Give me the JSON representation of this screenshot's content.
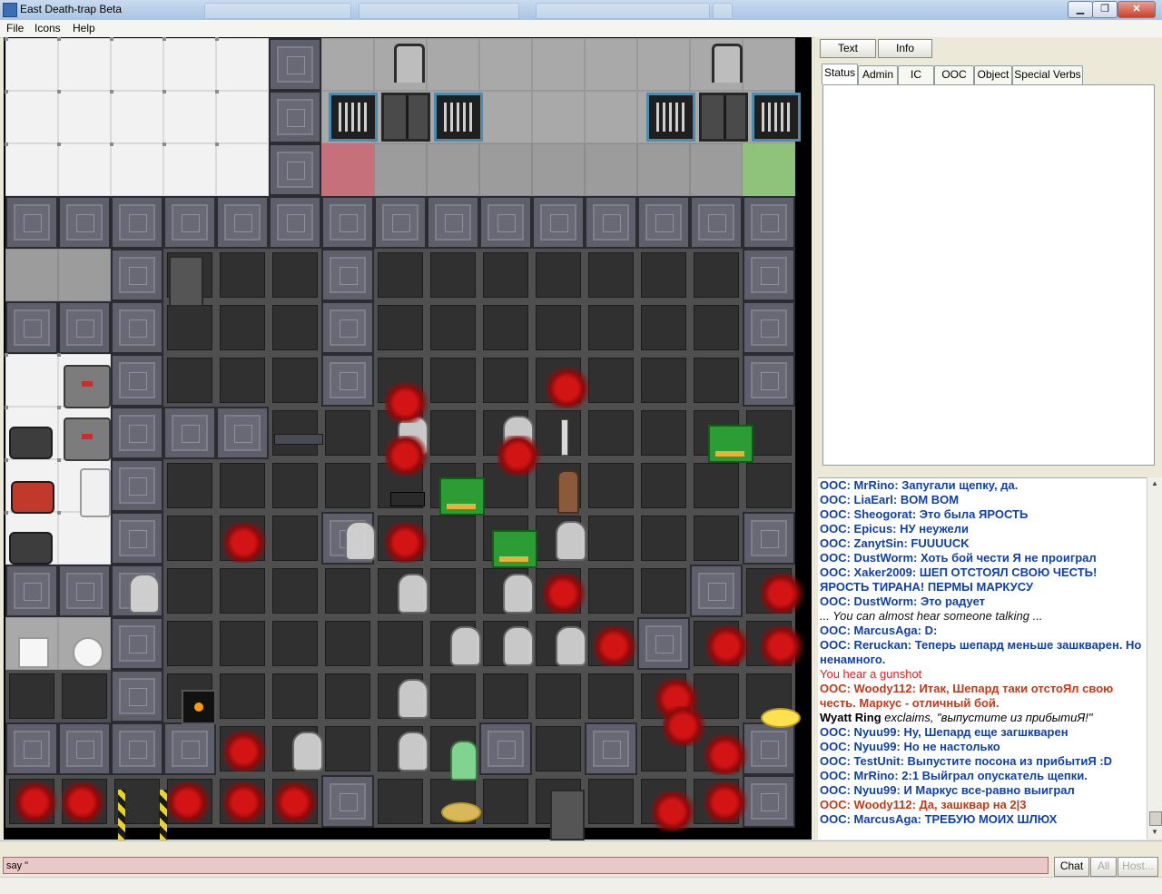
{
  "window": {
    "title": "East Death-trap Beta",
    "minimize": "▁",
    "restore": "❐",
    "close": "✕"
  },
  "menu": [
    "File",
    "Icons",
    "Help"
  ],
  "right_panel": {
    "top_buttons": [
      "Text",
      "Info"
    ],
    "tabs": [
      "Status",
      "Admin",
      "IC",
      "OOC",
      "Object",
      "Special Verbs"
    ]
  },
  "chat": [
    {
      "kind": "ooc",
      "text": "OOC: MrRino: Запугали щепку, да."
    },
    {
      "kind": "ooc",
      "text": "OOC: LiaEarl: BOM BOM"
    },
    {
      "kind": "ooc",
      "text": "OOC: Sheogorat: Это была ЯРОСТЬ"
    },
    {
      "kind": "ooc",
      "text": "OOC: Epicus: НУ неужели"
    },
    {
      "kind": "ooc",
      "text": "OOC: ZanytSin: FUUUUCK"
    },
    {
      "kind": "ooc",
      "text": "OOC: DustWorm: Хоть бой чести Я не проиграл"
    },
    {
      "kind": "ooc",
      "text": "OOC: Xaker2009: ШЕП ОТСТОЯЛ СВОЮ ЧЕСТЬ! ЯРОСТЬ ТИРАНА! ПЕРМЫ МАРКУСУ"
    },
    {
      "kind": "ooc",
      "text": "OOC: DustWorm: Это радует"
    },
    {
      "kind": "emote",
      "text": "... You can almost hear someone talking ..."
    },
    {
      "kind": "ooc",
      "text": "OOC: MarcusAga: D:"
    },
    {
      "kind": "ooc",
      "text": "OOC: Reruckan: Теперь шепард меньше зашкварен. Но ненамного."
    },
    {
      "kind": "alert",
      "text": "You hear a gunshot"
    },
    {
      "kind": "admin",
      "text": "OOC: Woody112: Итак, Шепард таки отстоЯл свою честь. Маркус - отличный бой."
    },
    {
      "kind": "say",
      "name": "Wyatt Ring",
      "text": " exclaims, \"выпустите из прибытиЯ!\""
    },
    {
      "kind": "ooc",
      "text": "OOC: Nyuu99: Ну, Шепард еще загшкварен"
    },
    {
      "kind": "ooc",
      "text": "OOC: Nyuu99: Но не настолько"
    },
    {
      "kind": "ooc",
      "text": "OOC: TestUnit: Выпустите посона из прибытиЯ :D"
    },
    {
      "kind": "ooc",
      "text": "OOC: MrRino: 2:1 Выйграл опускатель щепки."
    },
    {
      "kind": "ooc",
      "text": "OOC: Nyuu99: И Маркус все-равно выиграл"
    },
    {
      "kind": "admin",
      "text": "OOC: Woody112: Да, зашквар на 2|3"
    },
    {
      "kind": "ooc",
      "text": "OOC: MarcusAga: ТРЕБУЮ МОИХ ШЛЮХ"
    }
  ],
  "input": {
    "value": "say \""
  },
  "bottom_buttons": [
    "Chat",
    "All",
    "Host..."
  ],
  "colors": {
    "ooc": "#1040a8",
    "admin": "#c03a1a",
    "alert": "#e02020",
    "input_bg": "#e8c8c8"
  }
}
